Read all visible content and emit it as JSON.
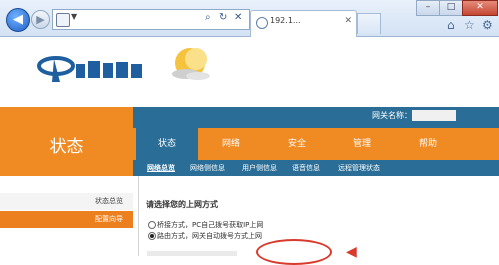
{
  "browser": {
    "back_icon": "back-arrow-icon",
    "forward_icon": "forward-arrow-icon",
    "tab_title": "192.1...",
    "toolbar_icons": [
      "home-icon",
      "star-icon",
      "gear-icon"
    ]
  },
  "header": {
    "gateway_label": "网关名称："
  },
  "section_title": "状态",
  "nav_tabs": [
    "状态",
    "网络",
    "安全",
    "管理",
    "帮助"
  ],
  "subnav": [
    "网络总览",
    "网络侧信息",
    "用户侧信息",
    "语音信息",
    "远程管理状态"
  ],
  "left_menu": [
    "状态总览",
    "配置向导"
  ],
  "content": {
    "title": "请选择您的上网方式",
    "option_1": "桥接方式，PC自己拨号获取IP上网",
    "option_2": "路由方式，网关自动拨号方式上网"
  },
  "colors": {
    "orange": "#f08a22",
    "blue": "#2a6e98",
    "highlight_red": "#d83a2b"
  }
}
